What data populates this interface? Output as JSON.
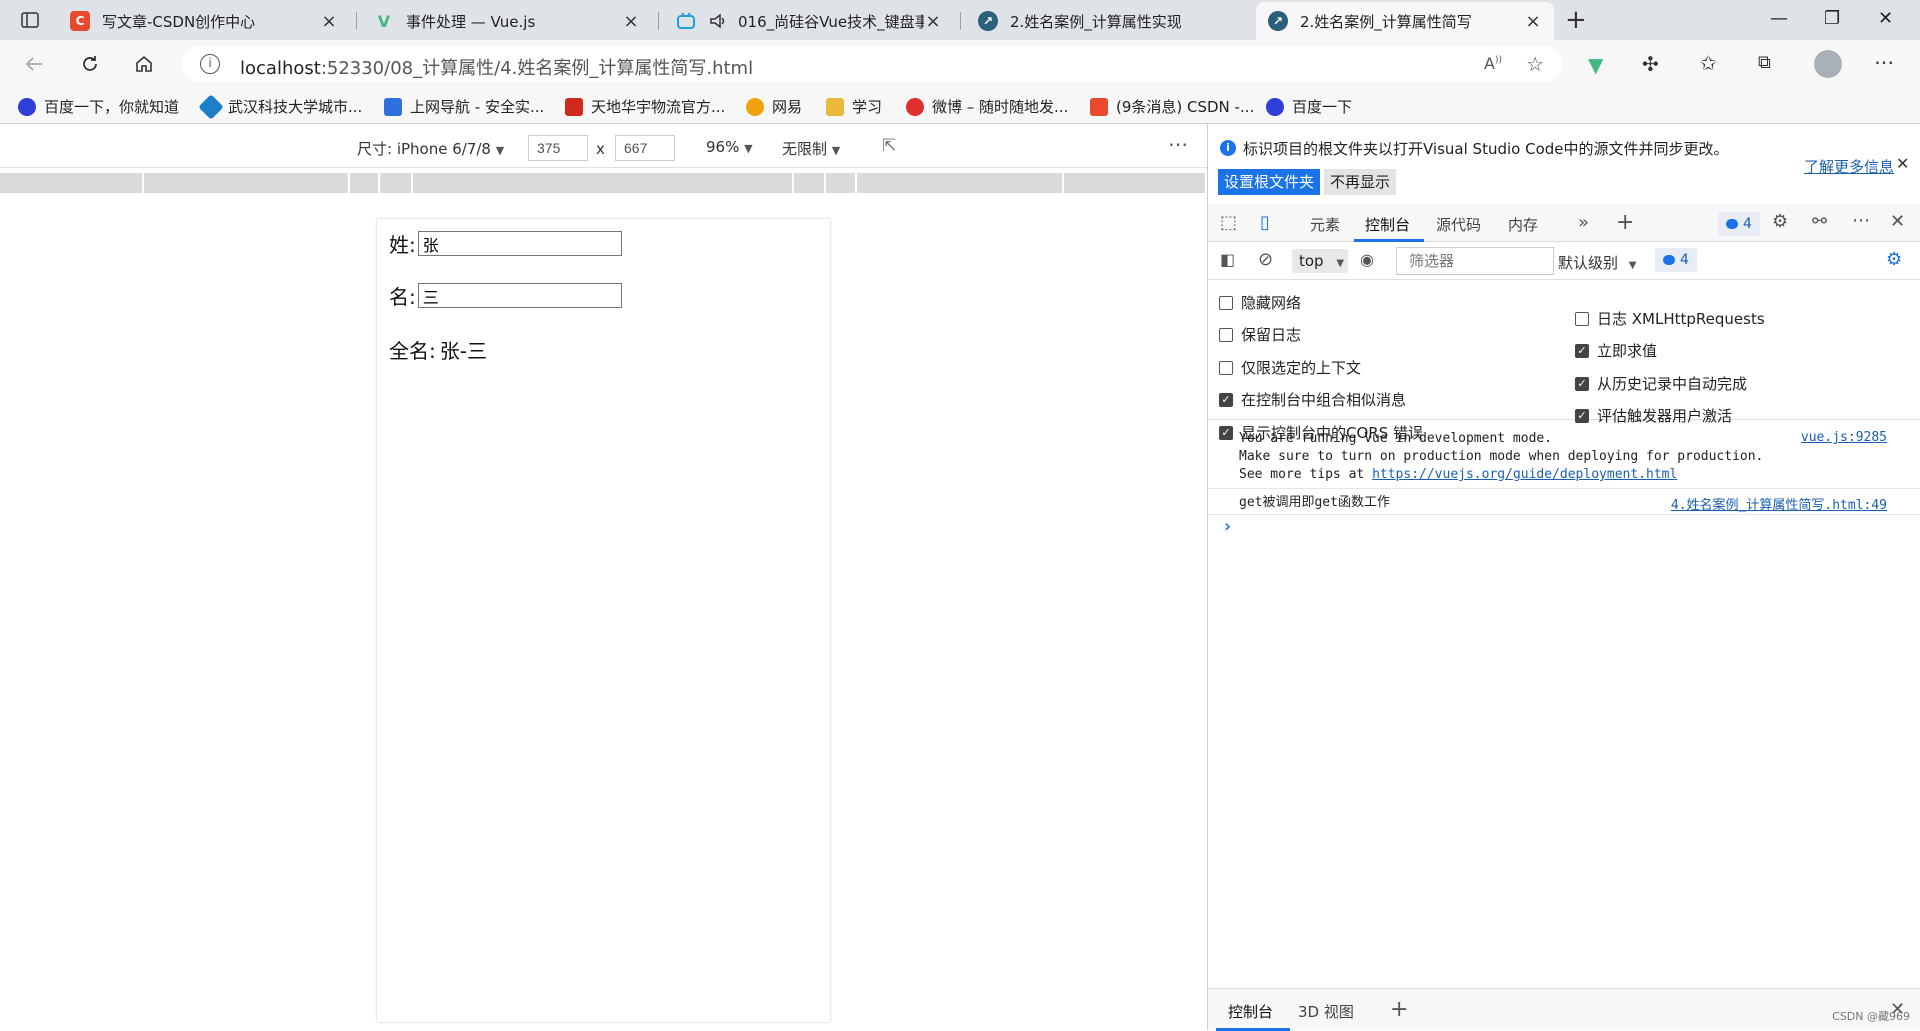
{
  "tabs": [
    {
      "label": "写文章-CSDN创作中心",
      "icon_color": "#e84a2e",
      "icon_char": "C"
    },
    {
      "label": "事件处理 — Vue.js",
      "icon_color": "#41b883",
      "icon_char": "V"
    },
    {
      "label": "016_尚硅谷Vue技术_键盘事",
      "icon_color": "#20a0d8",
      "icon_char": "b"
    },
    {
      "label": "2.姓名案例_计算属性实现",
      "icon_color": "#2b5f7a",
      "icon_char": "↗"
    },
    {
      "label": "2.姓名案例_计算属性简写",
      "icon_color": "#2b5f7a",
      "icon_char": "↗"
    }
  ],
  "address": {
    "host": "localhost",
    "rest": ":52330/08_计算属性/4.姓名案例_计算属性简写.html"
  },
  "bookmarks": [
    {
      "label": "百度一下，你就知道",
      "color": "#2f3fd9"
    },
    {
      "label": "武汉科技大学城市...",
      "color": "#1c7fc9"
    },
    {
      "label": "上网导航 - 安全实...",
      "color": "#2f6fe0"
    },
    {
      "label": "天地华宇物流官方...",
      "color": "#d02a1e"
    },
    {
      "label": "网易",
      "color": "#f2a20c"
    },
    {
      "label": "学习",
      "color": "#e8b93a"
    },
    {
      "label": "微博 – 随时随地发...",
      "color": "#e0302d"
    },
    {
      "label": "(9条消息) CSDN -...",
      "color": "#e84a2e"
    },
    {
      "label": "百度一下",
      "color": "#2f3fd9"
    }
  ],
  "device": {
    "size_label": "尺寸: iPhone 6/7/8",
    "width": "375",
    "height": "667",
    "x": "x",
    "zoom": "96%",
    "throttle": "无限制"
  },
  "app": {
    "last_label": "姓:",
    "last_value": "张",
    "first_label": "名:",
    "first_value": "三",
    "full_label": "全名:",
    "full_value": "张-三"
  },
  "devtools": {
    "info_text": "标识项目的根文件夹以打开Visual Studio Code中的源文件并同步更改。",
    "info_link": "了解更多信息",
    "btn_set_root": "设置根文件夹",
    "btn_dont_show": "不再显示",
    "tabs": [
      "元素",
      "控制台",
      "源代码",
      "内存"
    ],
    "badge_count": "4",
    "context": "top",
    "filter_placeholder": "筛选器",
    "level": "默认级别",
    "options_left": [
      {
        "label": "隐藏网络",
        "checked": false
      },
      {
        "label": "保留日志",
        "checked": false
      },
      {
        "label": "仅限选定的上下文",
        "checked": false
      },
      {
        "label": "在控制台中组合相似消息",
        "checked": true
      },
      {
        "label": "显示控制台中的CORS 错误",
        "checked": true
      }
    ],
    "options_right": [
      {
        "label": "日志 XMLHttpRequests",
        "checked": false
      },
      {
        "label": "立即求值",
        "checked": true
      },
      {
        "label": "从历史记录中自动完成",
        "checked": true
      },
      {
        "label": "评估触发器用户激活",
        "checked": true
      }
    ],
    "console": {
      "msg1_line1": "You are running Vue in development mode.",
      "msg1_line2": "Make sure to turn on production mode when deploying for production.",
      "msg1_line3_prefix": "See more tips at ",
      "msg1_link": "https://vuejs.org/guide/deployment.html",
      "msg1_src": "vue.js:9285",
      "msg2": "get被调用即get函数工作",
      "msg2_src": "4.姓名案例_计算属性简写.html:49",
      "prompt": "›"
    },
    "bottom_tabs": [
      "控制台",
      "3D 视图"
    ],
    "watermark": "CSDN @藏969"
  }
}
